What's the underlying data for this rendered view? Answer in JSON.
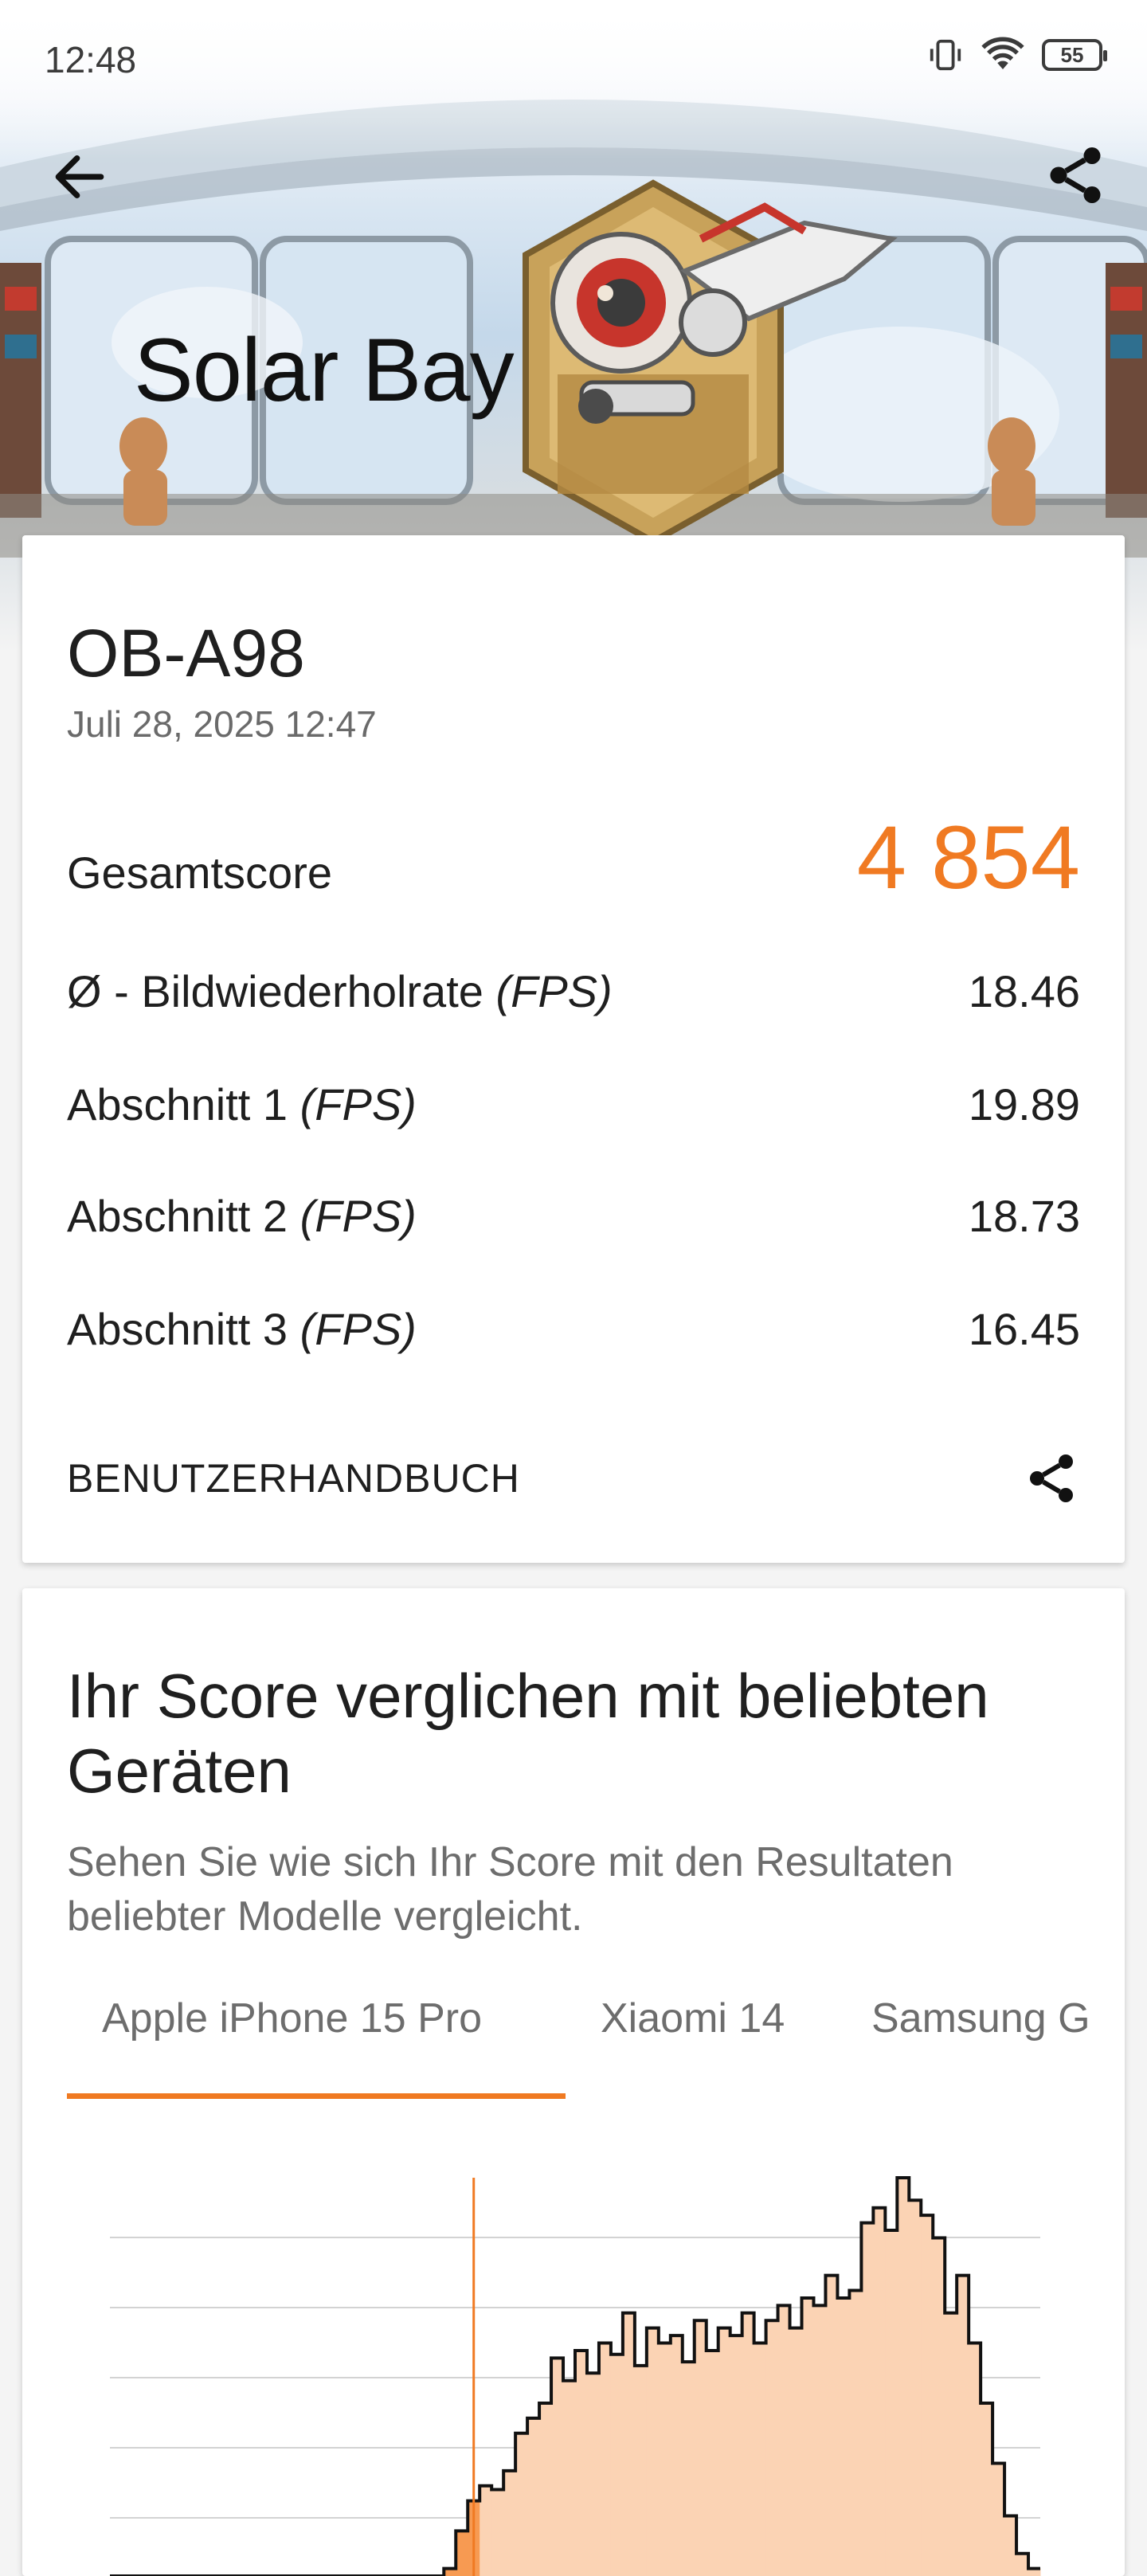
{
  "status_bar": {
    "time": "12:48",
    "battery": "55",
    "icons": [
      "vibrate-icon",
      "wifi-icon",
      "battery-icon"
    ]
  },
  "header": {
    "title": "Solar Bay",
    "back_icon": "arrow-back-icon",
    "share_icon": "share-icon"
  },
  "result": {
    "device": "OB-A98",
    "date": "Juli 28, 2025 12:47",
    "total_label": "Gesamtscore",
    "total_value": "4 854",
    "rows": [
      {
        "label": "Ø - Bildwiederholrate",
        "unit": "(FPS)",
        "value": "18.46"
      },
      {
        "label": "Abschnitt 1",
        "unit": "(FPS)",
        "value": "19.89"
      },
      {
        "label": "Abschnitt 2",
        "unit": "(FPS)",
        "value": "18.73"
      },
      {
        "label": "Abschnitt 3",
        "unit": "(FPS)",
        "value": "16.45"
      }
    ],
    "manual_label": "BENUTZERHANDBUCH"
  },
  "compare": {
    "title": "Ihr Score verglichen mit beliebten Geräten",
    "subtitle": "Sehen Sie wie sich Ihr Score mit den Resultaten beliebter Modelle vergleicht.",
    "tabs": [
      "Apple iPhone 15 Pro",
      "Xiaomi 14",
      "Samsung G"
    ],
    "selected_tab": 0
  },
  "colors": {
    "accent": "#f07a22",
    "histogram_fill": "#fbd3b4",
    "histogram_highlight": "#f79a52"
  },
  "chart_data": {
    "type": "area",
    "title": "",
    "xlabel": "",
    "ylabel": "",
    "score_marker_index": 30,
    "visible_values": [
      0,
      0,
      0,
      0,
      0,
      0,
      0,
      0,
      0,
      0,
      0,
      0,
      0,
      0,
      0,
      0,
      0,
      0,
      0,
      0,
      0,
      0,
      0,
      0,
      0,
      0,
      0,
      0,
      2,
      12,
      20,
      24,
      23,
      28,
      38,
      42,
      46,
      58,
      52,
      60,
      54,
      62,
      59,
      70,
      56,
      66,
      62,
      64,
      57,
      68,
      60,
      66,
      64,
      70,
      62,
      68,
      72,
      66,
      74,
      72,
      80,
      74,
      76,
      94,
      98,
      92,
      106,
      100,
      96,
      90,
      70,
      80,
      62,
      46,
      30,
      16,
      6,
      2
    ]
  }
}
